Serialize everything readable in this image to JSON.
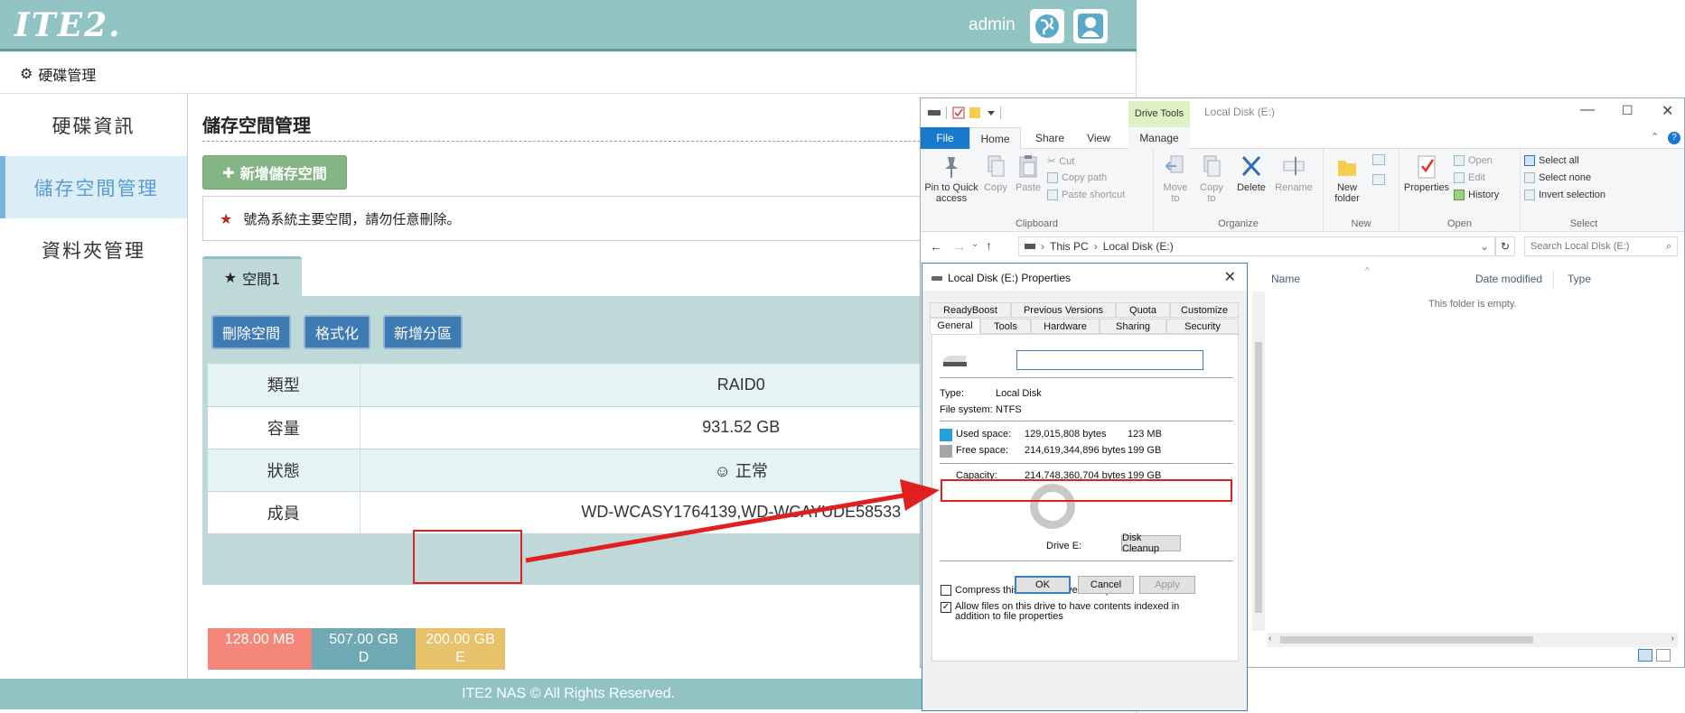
{
  "nas": {
    "logo": "ITE2.",
    "user": "admin",
    "breadcrumb": "硬碟管理",
    "sidebar": {
      "items": [
        {
          "label": "硬碟資訊"
        },
        {
          "label": "儲存空間管理"
        },
        {
          "label": "資料夾管理"
        }
      ]
    },
    "page_title": "儲存空間管理",
    "add_storage_label": "新增儲存空間",
    "notice": "號為系統主要空間，請勿任意刪除。",
    "space_tab": "空間1",
    "actions": {
      "delete": "刪除空間",
      "format": "格式化",
      "add_partition": "新增分區"
    },
    "table": [
      {
        "key": "類型",
        "value": "RAID0"
      },
      {
        "key": "容量",
        "value": "931.52 GB"
      },
      {
        "key": "狀態",
        "value": "☺ 正常"
      },
      {
        "key": "成員",
        "value": "WD-WCASY1764139,WD-WCAYUDE58533"
      }
    ],
    "partitions": [
      {
        "size": "128.00 MB",
        "letter": "",
        "color": "#f4877a",
        "fraction": 0.0001
      },
      {
        "size": "507.00 GB",
        "letter": "D",
        "color": "#6fa9b3",
        "fraction": 0.5443
      },
      {
        "size": "200.00 GB",
        "letter": "E",
        "color": "#e8c16b",
        "fraction": 0.2147
      }
    ],
    "footer": "ITE2 NAS © All Rights Reserved."
  },
  "explorer": {
    "context_tab": "Drive Tools",
    "title": "Local Disk (E:)",
    "tabs": {
      "file": "File",
      "home": "Home",
      "share": "Share",
      "view": "View",
      "manage": "Manage"
    },
    "ribbon": {
      "pin": "Pin to Quick access",
      "copy": "Copy",
      "paste": "Paste",
      "cut": "Cut",
      "copy_path": "Copy path",
      "paste_shortcut": "Paste shortcut",
      "clipboard": "Clipboard",
      "move_to": "Move to",
      "copy_to": "Copy to",
      "delete": "Delete",
      "rename": "Rename",
      "organize": "Organize",
      "new_folder": "New folder",
      "new": "New",
      "properties": "Properties",
      "open_small": "Open",
      "edit": "Edit",
      "history": "History",
      "open": "Open",
      "select_all": "Select all",
      "select_none": "Select none",
      "invert_selection": "Invert selection",
      "select": "Select"
    },
    "address": {
      "this_pc": "This PC",
      "drive": "Local Disk (E:)"
    },
    "search_placeholder": "Search Local Disk (E:)",
    "columns": {
      "name": "Name",
      "date_modified": "Date modified",
      "type": "Type"
    },
    "empty": "This folder is empty."
  },
  "props": {
    "title": "Local Disk (E:) Properties",
    "tabs_row1": [
      "ReadyBoost",
      "Previous Versions",
      "Quota",
      "Customize"
    ],
    "tabs_row2": [
      "General",
      "Tools",
      "Hardware",
      "Sharing",
      "Security"
    ],
    "type_label": "Type:",
    "type_value": "Local Disk",
    "fs_label": "File system:",
    "fs_value": "NTFS",
    "used_label": "Used space:",
    "used_bytes": "129,015,808 bytes",
    "used_size": "123 MB",
    "used_color": "#26a0da",
    "free_label": "Free space:",
    "free_bytes": "214,619,344,896 bytes",
    "free_size": "199 GB",
    "free_color": "#a6a6a6",
    "cap_label": "Capacity:",
    "cap_bytes": "214,748,360,704 bytes",
    "cap_size": "199 GB",
    "drive_label": "Drive E:",
    "cleanup": "Disk Cleanup",
    "compress": "Compress this drive to save disk space",
    "index": "Allow files on this drive to have contents indexed in addition to file properties",
    "ok": "OK",
    "cancel": "Cancel",
    "apply": "Apply"
  }
}
